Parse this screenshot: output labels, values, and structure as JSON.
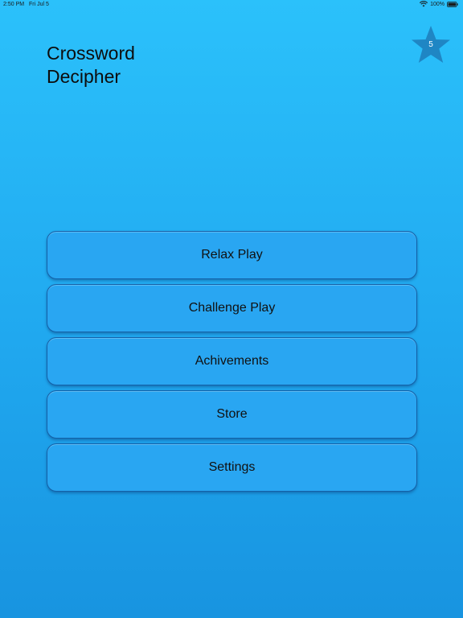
{
  "status_bar": {
    "time": "2:50 PM",
    "date": "Fri Jul 5",
    "battery_percent": "100%",
    "battery_level": 1.0,
    "icons": [
      "wifi-icon",
      "battery-icon"
    ]
  },
  "title": {
    "line1": "Crossword",
    "line2": "Decipher"
  },
  "badge": {
    "icon": "star-icon",
    "count": "5",
    "color": "#1f86c4"
  },
  "menu": {
    "items": [
      {
        "label": "Relax Play"
      },
      {
        "label": "Challenge Play"
      },
      {
        "label": "Achivements"
      },
      {
        "label": "Store"
      },
      {
        "label": "Settings"
      }
    ]
  },
  "colors": {
    "background_top": "#2bc1fb",
    "background_bottom": "#1894e0",
    "button_fill": "#29a6f2",
    "button_border": "#1461a8"
  }
}
